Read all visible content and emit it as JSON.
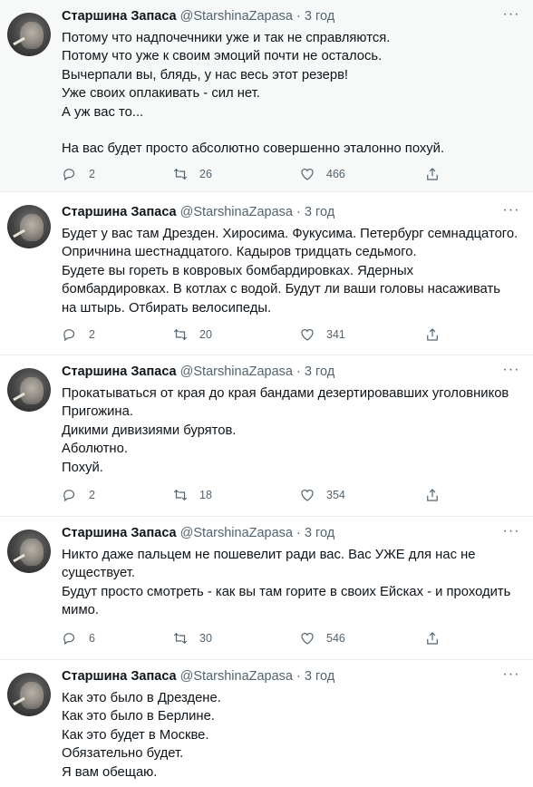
{
  "colors": {
    "text": "#0f1419",
    "secondary": "#536471",
    "highlight_bg": "#f7f9f9",
    "divider": "#e6ecf0"
  },
  "tweets": [
    {
      "name": "Старшина Запаса",
      "handle": "@StarshinaZapasa",
      "dot": "·",
      "time": "3 год",
      "lines": [
        "Потому что надпочечники уже и так не справляются.",
        "Потому что уже к своим эмоций почти не осталось.",
        "Вычерпали вы, блядь, у нас весь этот резерв!",
        "Уже своих оплакивать - сил нет.",
        "А уж вас то...",
        "",
        "На вас будет просто абсолютно совершенно эталонно похуй."
      ],
      "replies": "2",
      "retweets": "26",
      "likes": "466"
    },
    {
      "name": "Старшина Запаса",
      "handle": "@StarshinaZapasa",
      "dot": "·",
      "time": "3 год",
      "lines": [
        "Будет у вас там Дрезден. Хиросима. Фукусима. Петербург семнадцатого.",
        "Опричнина шестнадцатого. Кадыров тридцать седьмого.",
        "Будете вы гореть в ковровых бомбардировках. Ядерных",
        "бомбардировках. В котлах с водой. Будут ли ваши головы насаживать",
        "на штырь. Отбирать велосипеды."
      ],
      "replies": "2",
      "retweets": "20",
      "likes": "341"
    },
    {
      "name": "Старшина Запаса",
      "handle": "@StarshinaZapasa",
      "dot": "·",
      "time": "3 год",
      "lines": [
        "Прокатываться от края до края бандами дезертировавших уголовников",
        "Пригожина.",
        "Дикими дивизиями бурятов.",
        "Аболютно.",
        "Похуй."
      ],
      "replies": "2",
      "retweets": "18",
      "likes": "354"
    },
    {
      "name": "Старшина Запаса",
      "handle": "@StarshinaZapasa",
      "dot": "·",
      "time": "3 год",
      "lines": [
        "Никто даже пальцем не пошевелит ради вас. Вас УЖЕ для нас не",
        "существует.",
        "Будут просто смотреть - как вы там горите в своих Ейсках - и проходить",
        "мимо."
      ],
      "replies": "6",
      "retweets": "30",
      "likes": "546"
    },
    {
      "name": "Старшина Запаса",
      "handle": "@StarshinaZapasa",
      "dot": "·",
      "time": "3 год",
      "lines": [
        "Как это было в Дрездене.",
        "Как это было в Берлине.",
        "Как это будет в Москве.",
        "Обязательно будет.",
        "Я вам обещаю."
      ]
    }
  ]
}
